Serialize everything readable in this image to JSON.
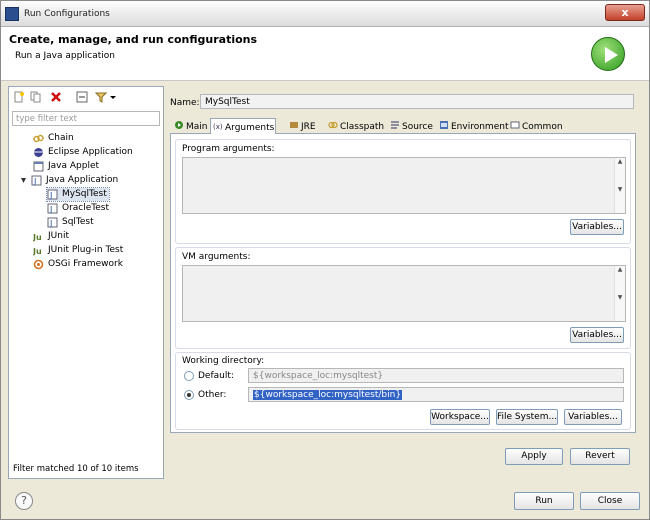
{
  "window": {
    "title": "Run Configurations",
    "close_label": "x"
  },
  "header": {
    "title": "Create, manage, and run configurations",
    "subtitle": "Run a Java application"
  },
  "left": {
    "filter_placeholder": "type filter text",
    "tree": [
      {
        "label": "Chain",
        "icon": "chain-icon"
      },
      {
        "label": "Eclipse Application",
        "icon": "eclipse-icon"
      },
      {
        "label": "Java Applet",
        "icon": "applet-icon"
      },
      {
        "label": "Java Application",
        "icon": "java-app-icon",
        "expanded": "true"
      },
      {
        "label": "MySqlTest",
        "icon": "java-class-icon",
        "selected": "true"
      },
      {
        "label": "OracleTest",
        "icon": "java-class-icon"
      },
      {
        "label": "SqlTest",
        "icon": "java-class-icon"
      },
      {
        "label": "JUnit",
        "icon": "junit-icon"
      },
      {
        "label": "JUnit Plug-in Test",
        "icon": "junit-plugin-icon"
      },
      {
        "label": "OSGi Framework",
        "icon": "osgi-icon"
      }
    ],
    "status": "Filter matched 10 of 10 items"
  },
  "config": {
    "name_label": "Name:",
    "name_value": "MySqlTest",
    "tabs": [
      "Main",
      "Arguments",
      "JRE",
      "Classpath",
      "Source",
      "Environment",
      "Common"
    ],
    "active_tab": "Arguments",
    "program_args_label": "Program arguments:",
    "vm_args_label": "VM arguments:",
    "variables_label": "Variables...",
    "working_dir_label": "Working directory:",
    "default_label": "Default:",
    "default_value": "${workspace_loc:mysqltest}",
    "other_label": "Other:",
    "other_value": "${workspace_loc:mysqltest/bin}",
    "workspace_btn": "Workspace...",
    "filesystem_btn": "File System...",
    "variables_btn": "Variables..."
  },
  "footer": {
    "apply": "Apply",
    "revert": "Revert",
    "run": "Run",
    "close": "Close",
    "help": "?"
  }
}
